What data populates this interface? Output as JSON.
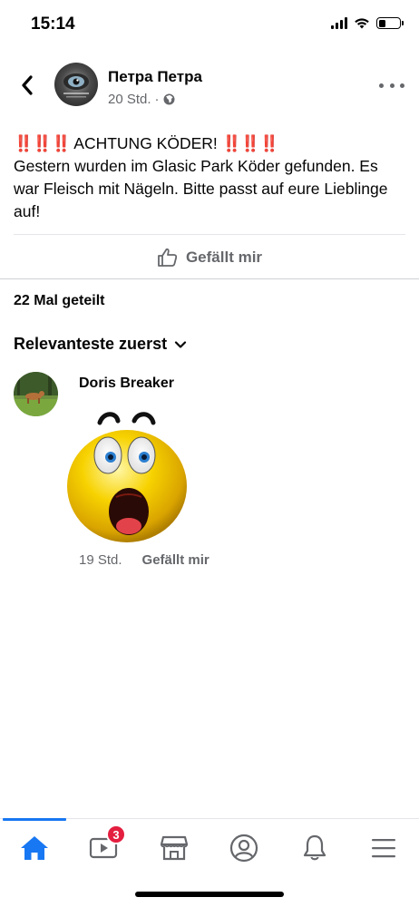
{
  "status_bar": {
    "time": "15:14",
    "icons": [
      "signal-icon",
      "wifi-icon",
      "battery-icon"
    ],
    "battery_level": 0.35
  },
  "post": {
    "author": "Петра Петра",
    "time": "20 Std.",
    "separator": "·",
    "privacy_icon": "globe-icon",
    "warning_emoji": "‼️‼️‼️",
    "headline": "ACHTUNG KÖDER!",
    "body": "Gestern wurden im Glasic Park Köder gefunden. Es war Fleisch mit Nägeln. Bitte passt auf eure Lieblinge auf!",
    "like_label": "Gefällt mir",
    "like_icon": "thumbs-up-icon"
  },
  "shares": "22 Mal geteilt",
  "sort": {
    "label": "Relevanteste zuerst",
    "icon": "chevron-down-icon"
  },
  "comments": [
    {
      "author": "Doris Breaker",
      "sticker": "shocked-emoji-sticker",
      "time": "19 Std.",
      "like_label": "Gefällt mir"
    }
  ],
  "bottom_nav": {
    "items": [
      {
        "name": "home",
        "icon": "home-icon",
        "active": true
      },
      {
        "name": "watch",
        "icon": "video-icon",
        "badge": "3"
      },
      {
        "name": "marketplace",
        "icon": "store-icon"
      },
      {
        "name": "profile",
        "icon": "profile-icon"
      },
      {
        "name": "notifications",
        "icon": "bell-icon"
      },
      {
        "name": "menu",
        "icon": "menu-icon"
      }
    ]
  },
  "colors": {
    "accent": "#1877f2",
    "warning_red": "#e0241b",
    "secondary_text": "#65676b",
    "badge_red": "#e41e3f"
  }
}
